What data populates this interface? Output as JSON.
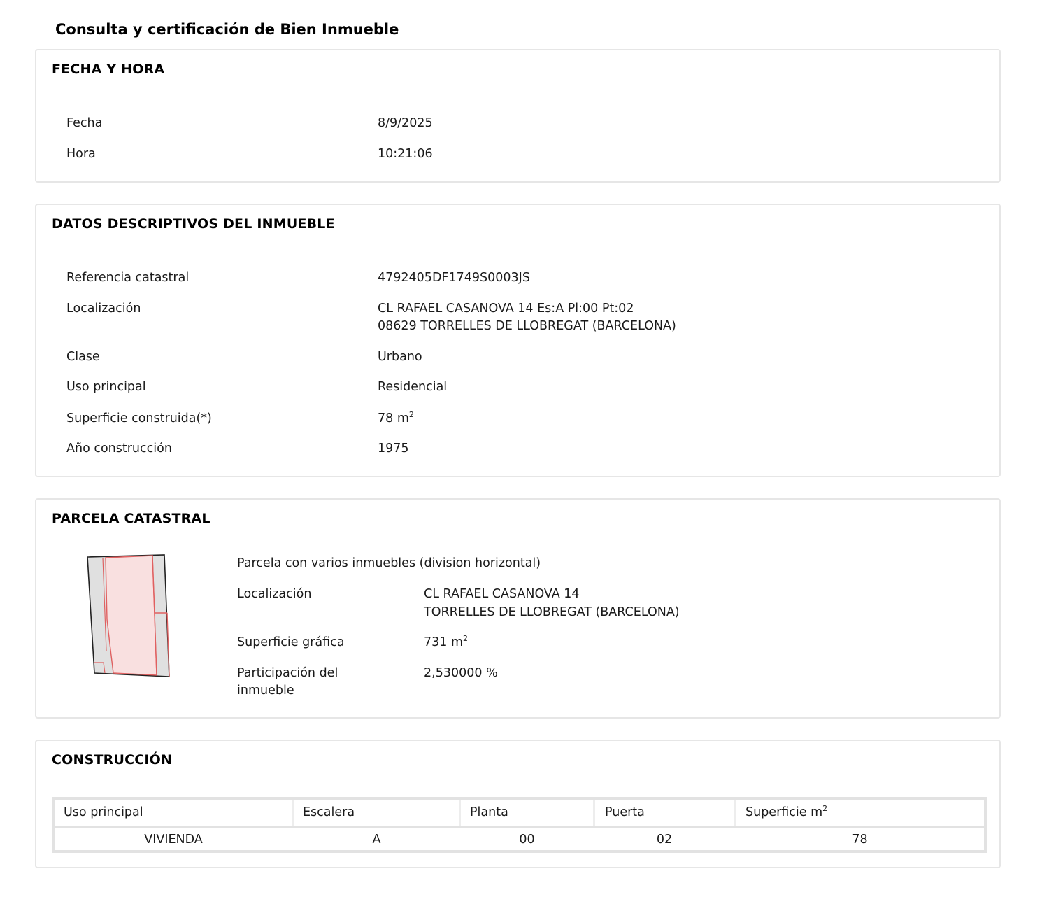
{
  "title": "Consulta y certificación de Bien Inmueble",
  "fecha_hora": {
    "heading": "FECHA Y HORA",
    "rows": [
      {
        "label": "Fecha",
        "value": "8/9/2025"
      },
      {
        "label": "Hora",
        "value": "10:21:06"
      }
    ]
  },
  "datos": {
    "heading": "DATOS DESCRIPTIVOS DEL INMUEBLE",
    "referencia_label": "Referencia catastral",
    "referencia_value": "4792405DF1749S0003JS",
    "localizacion_label": "Localización",
    "localizacion_line1": "CL RAFAEL CASANOVA 14 Es:A Pl:00 Pt:02",
    "localizacion_line2": "08629 TORRELLES DE LLOBREGAT (BARCELONA)",
    "clase_label": "Clase",
    "clase_value": "Urbano",
    "uso_label": "Uso principal",
    "uso_value": "Residencial",
    "superficie_label": "Superficie construida(*)",
    "superficie_value": "78 m",
    "superficie_sup": "2",
    "anio_label": "Año construcción",
    "anio_value": "1975"
  },
  "parcela": {
    "heading": "PARCELA CATASTRAL",
    "description": "Parcela con varios inmuebles (division horizontal)",
    "localizacion_label": "Localización",
    "localizacion_line1": "CL RAFAEL CASANOVA 14",
    "localizacion_line2": "TORRELLES DE LLOBREGAT (BARCELONA)",
    "superficie_label": "Superficie gráfica",
    "superficie_value": "731 m",
    "superficie_sup": "2",
    "participacion_label_1": "Participación del",
    "participacion_label_2": "inmueble",
    "participacion_value": "2,530000 %"
  },
  "construccion": {
    "heading": "CONSTRUCCIÓN",
    "headers": [
      "Uso principal",
      "Escalera",
      "Planta",
      "Puerta",
      "Superficie m"
    ],
    "header_sup": "2",
    "rows": [
      [
        "VIVIENDA",
        "A",
        "00",
        "02",
        "78"
      ]
    ]
  },
  "colors": {
    "border": "#e6e6e6",
    "parcel_fill": "#f9e0e0",
    "parcel_line": "#e06060",
    "parcel_grey": "#e0e0e0"
  }
}
